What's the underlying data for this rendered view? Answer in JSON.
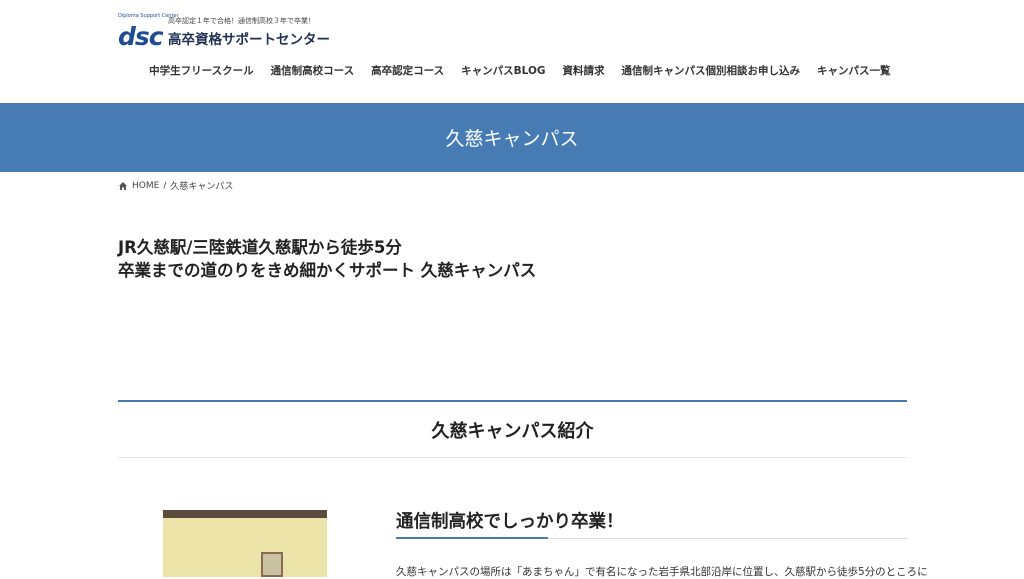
{
  "header": {
    "logo_mark": "dsc",
    "logo_mark_small": "Diploma Support Center",
    "tagline": "高卒認定１年で合格！通信制高校３年で卒業！",
    "site_name": "高卒資格サポートセンター"
  },
  "nav": [
    "中学生フリースクール",
    "通信制高校コース",
    "高卒認定コース",
    "キャンパスBLOG",
    "資料請求",
    "通信制キャンパス個別相談お申し込み",
    "キャンパス一覧"
  ],
  "banner": {
    "title": "久慈キャンパス"
  },
  "breadcrumb": {
    "home": "HOME",
    "separator": "/",
    "current": "久慈キャンパス"
  },
  "intro": {
    "line1": "JR久慈駅/三陸鉄道久慈駅から徒歩5分",
    "line2": "卒業までの道のりをきめ細かくサポート 久慈キャンパス"
  },
  "section": {
    "title": "久慈キャンパス紹介"
  },
  "feature": {
    "heading": "通信制高校でしっかり卒業！",
    "text": "久慈キャンパスの場所は「あまちゃん」で有名になった岩手県北部沿岸に位置し、久慈駅から徒歩5分のところに"
  },
  "colors": {
    "accent": "#467bb3",
    "brand": "#1f4c92"
  },
  "icons": {
    "home": "home-icon"
  }
}
